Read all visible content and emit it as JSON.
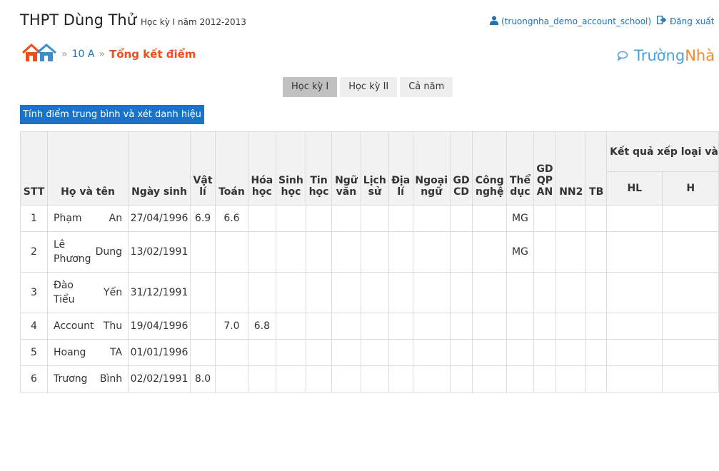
{
  "header": {
    "school_name": "THPT Dùng Thử",
    "semester_year": "Học kỳ I năm 2012-2013",
    "account": "(truongnha_demo_account_school)",
    "logout": "Đăng xuất"
  },
  "breadcrumb": {
    "class_name": "10 A",
    "current": "Tổng kết điểm"
  },
  "brand": {
    "part1": "Trường",
    "part2": "Nhà"
  },
  "tabs": [
    {
      "label": "Học kỳ I",
      "active": true
    },
    {
      "label": "Học kỳ II",
      "active": false
    },
    {
      "label": "Cả năm",
      "active": false
    }
  ],
  "calc_button": "Tính điểm trung bình và xét danh hiệu",
  "table": {
    "headers": {
      "stt": "STT",
      "name": "Họ và tên",
      "dob": "Ngày sinh",
      "physics": "Vật lí",
      "math": "Toán",
      "chemistry": "Hóa học",
      "biology": "Sinh học",
      "informatics": "Tin học",
      "literature": "Ngữ văn",
      "history": "Lịch sử",
      "geography": "Địa lí",
      "foreign_language": "Ngoại ngữ",
      "civic": "GD CD",
      "technology": "Công nghệ",
      "pe": "Thể dục",
      "defense": "GD QP AN",
      "nn2": "NN2",
      "tb": "TB",
      "result": "Kết quả xếp loại và",
      "hl": "HL",
      "hk": "H"
    },
    "rows": [
      {
        "stt": "1",
        "last": "Phạm",
        "first": "An",
        "dob": "27/04/1996",
        "physics": "6.9",
        "math": "6.6",
        "chemistry": "",
        "pe": "MG"
      },
      {
        "stt": "2",
        "last": "Lê Phương",
        "first": "Dung",
        "dob": "13/02/1991",
        "physics": "",
        "math": "",
        "chemistry": "",
        "pe": "MG"
      },
      {
        "stt": "3",
        "last": "Đào Tiểu",
        "first": "Yến",
        "dob": "31/12/1991",
        "physics": "",
        "math": "",
        "chemistry": "",
        "pe": ""
      },
      {
        "stt": "4",
        "last": "Account",
        "first": "Thu",
        "dob": "19/04/1996",
        "physics": "",
        "math": "7.0",
        "chemistry": "6.8",
        "pe": ""
      },
      {
        "stt": "5",
        "last": "Hoang",
        "first": "TA",
        "dob": "01/01/1996",
        "physics": "",
        "math": "",
        "chemistry": "",
        "pe": ""
      },
      {
        "stt": "6",
        "last": "Trương",
        "first": "Bình",
        "dob": "02/02/1991",
        "physics": "8.0",
        "math": "",
        "chemistry": "",
        "pe": ""
      }
    ]
  },
  "icons": {
    "home": "home-icon",
    "user": "user-icon",
    "logout": "sign-out-icon",
    "brand": "chat-bubble-icon"
  }
}
